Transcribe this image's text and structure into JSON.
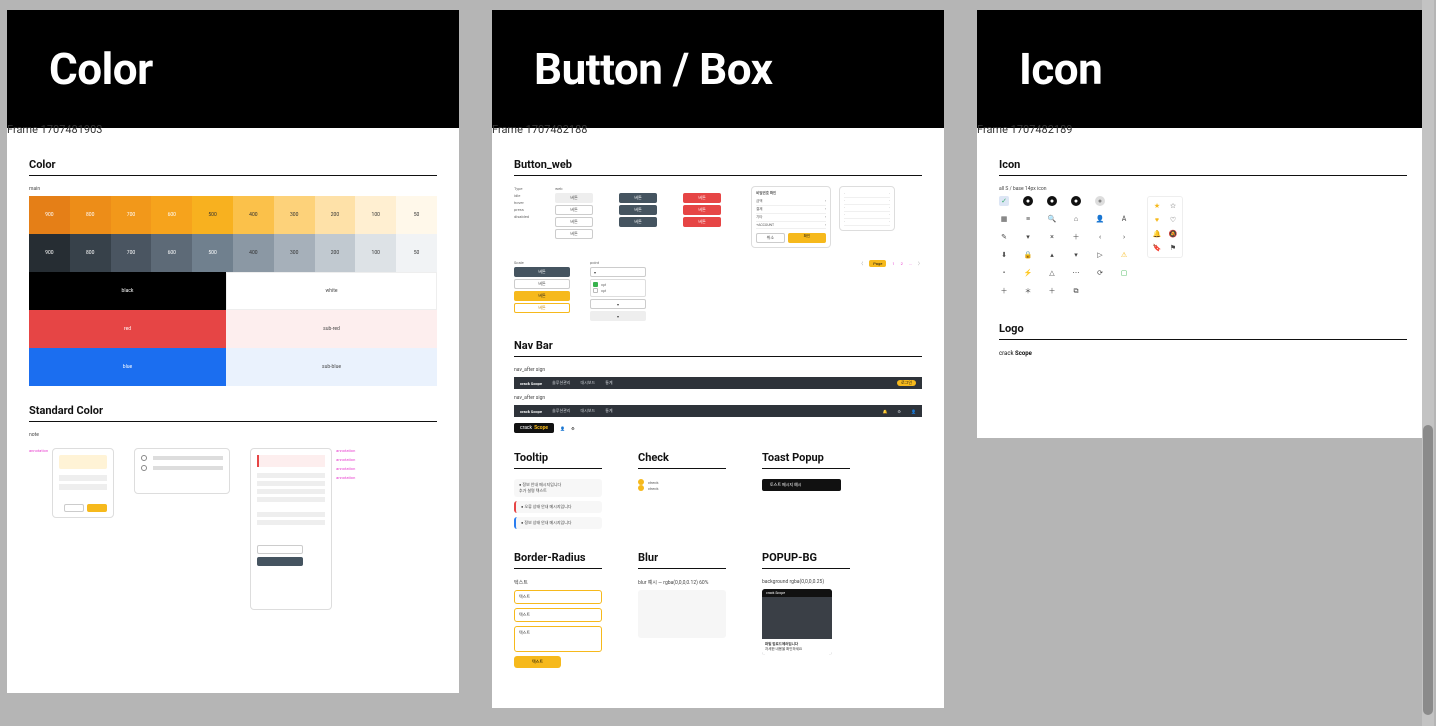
{
  "frames": {
    "color": {
      "label": "Frame 1707481903",
      "title": "Color"
    },
    "button": {
      "label": "Frame 1707482188",
      "title": "Button / Box"
    },
    "icon": {
      "label": "Frame 1707482189",
      "title": "Icon"
    }
  },
  "color_panel": {
    "heading": "Color",
    "sub_label": "main",
    "orange": {
      "shades": [
        "900",
        "800",
        "700",
        "600",
        "500",
        "400",
        "300",
        "200",
        "100",
        "50"
      ],
      "hex": [
        "#e57f17",
        "#ed8d18",
        "#f2981a",
        "#f6a31c",
        "#f8b11f",
        "#fbc14a",
        "#fdd27a",
        "#fee1a8",
        "#ffefd1",
        "#fff8ea"
      ]
    },
    "gray": {
      "shades": [
        "900",
        "800",
        "700",
        "600",
        "500",
        "400",
        "300",
        "200",
        "100",
        "50"
      ],
      "hex": [
        "#262d33",
        "#37414a",
        "#4a5561",
        "#5d6a77",
        "#70808e",
        "#8b98a4",
        "#a6b0ba",
        "#c1c9d0",
        "#dde2e6",
        "#f1f3f5"
      ]
    },
    "blocks": {
      "black": {
        "left_label": "black",
        "right_label": "white",
        "left": "#000000",
        "right": "#ffffff"
      },
      "red": {
        "left_label": "red",
        "right_label": "sub-red",
        "left": "#e64545",
        "right": "#fdeeee"
      },
      "blue": {
        "left_label": "blue",
        "right_label": "sub-blue",
        "left": "#1b6ef0",
        "right": "#eaf2fd"
      }
    },
    "standard_heading": "Standard Color",
    "standard_sub": "note",
    "anno_text": "annotation"
  },
  "button_panel": {
    "heading": "Button_web",
    "col_labels": {
      "type": "Type",
      "web": "web",
      "point": "point"
    },
    "states": [
      "idle",
      "hover",
      "press",
      "disabled"
    ],
    "btn_labels": {
      "generic": "버튼",
      "confirm": "확인",
      "cancel": "취소"
    },
    "scale_label": "Scale",
    "popup_mock": {
      "title": "비밀번호 확인",
      "rows": [
        "금액",
        "결제",
        "기타",
        "+ACCOUNT"
      ],
      "cancel": "취소",
      "ok": "확인"
    },
    "pager": {
      "prev": "〈",
      "page": "Page",
      "p1": "1",
      "p2": "2",
      "etc": "...",
      "next": "〉"
    },
    "nav_heading": "Nav Bar",
    "nav_sub1": "nav_after sign",
    "nav_sub2": "nav_after sign",
    "nav": {
      "brand_a": "crack",
      "brand_b": "Scope",
      "m1": "솔루션관리",
      "m2": "대시보드",
      "m3": "통계",
      "login": "로그인"
    },
    "tooltip_heading": "Tooltip",
    "tooltip_lines": [
      "정보 안내 메시지입니다",
      "추가 설명 텍스트",
      "오류 상태 안내 메시지입니다",
      "정보 상태 안내 메시지입니다"
    ],
    "check_heading": "Check",
    "check_labels": [
      "check",
      "check"
    ],
    "toast_heading": "Toast Popup",
    "toast_text": "토스트 메시지 예시",
    "br_heading": "Border-Radius",
    "br_labels": [
      "텍스트",
      "텍스트",
      "텍스트",
      "텍스트",
      "텍스트"
    ],
    "blur_heading": "Blur",
    "blur_note": "blur 예시 — rgba(0,0,0,0.12) 60%",
    "popup_heading": "POPUP-BG",
    "popup_note": "background rgba(0,0,0,0.25)",
    "popup_sheet": {
      "t": "파일 업로드에러입니다",
      "s": "자세한 내용을 확인하세요"
    }
  },
  "icon_panel": {
    "heading": "Icon",
    "note": "all S / base 14px icon",
    "logo_heading": "Logo",
    "logo": {
      "a": "crack",
      "b": "Scope"
    }
  }
}
